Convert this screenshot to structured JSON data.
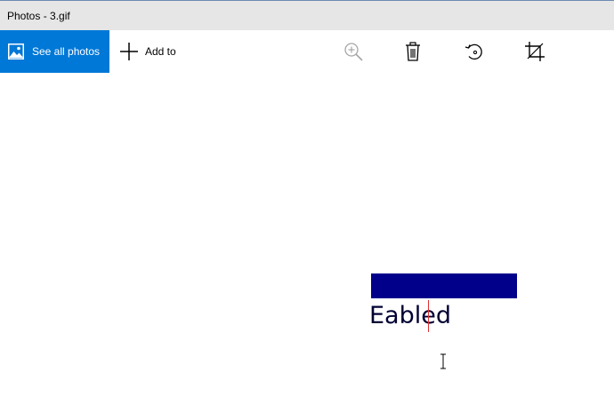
{
  "window": {
    "title": "Photos - 3.gif"
  },
  "toolbar": {
    "see_all_label": "See all photos",
    "add_to_label": "Add to",
    "icons": [
      "photos-icon",
      "plus-icon",
      "zoom-icon",
      "delete-icon",
      "rotate-icon",
      "crop-icon"
    ],
    "accent_color": "#0078d7"
  },
  "image": {
    "text": "Eabled",
    "bar_color": "#00008b",
    "caret_color": "#e03030"
  }
}
